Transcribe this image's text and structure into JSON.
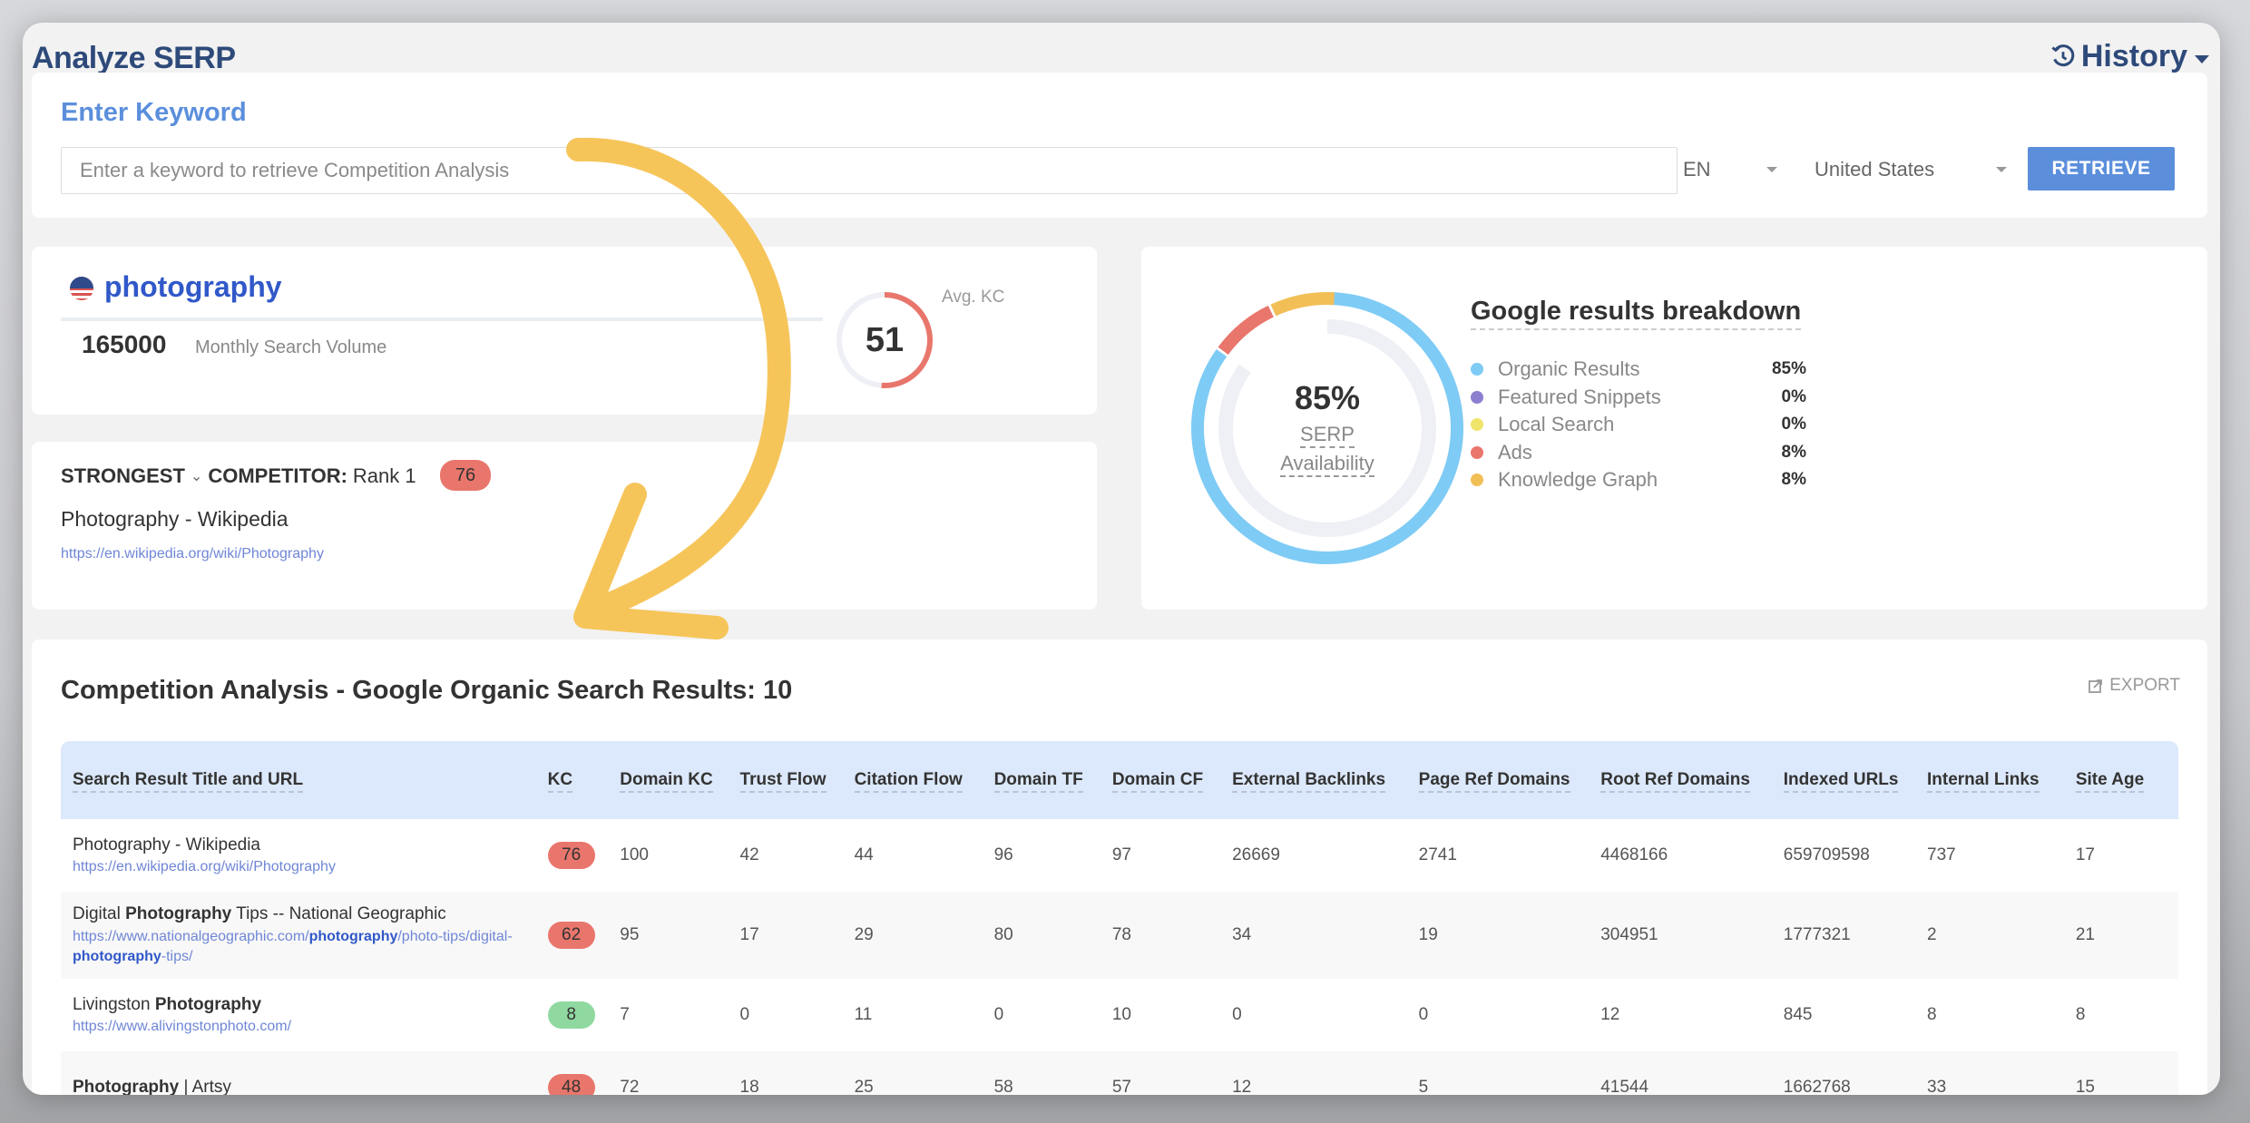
{
  "header": {
    "title": "Analyze SERP",
    "history_label": "History"
  },
  "keyword_form": {
    "label": "Enter Keyword",
    "input_value": "",
    "input_placeholder": "Enter a keyword to retrieve Competition Analysis",
    "language": "EN",
    "country": "United States",
    "retrieve_label": "RETRIEVE"
  },
  "summary": {
    "keyword": "photography",
    "flag": "us-flag-icon",
    "monthly_search_volume": "165000",
    "monthly_search_volume_label": "Monthly Search Volume",
    "avg_kc": "51",
    "avg_kc_fraction": 0.51,
    "avg_kc_label": "Avg. KC"
  },
  "strongest_competitor": {
    "label_strongest": "STRONGEST",
    "label_competitor": "COMPETITOR:",
    "rank_text": "Rank 1",
    "kc": "76",
    "title_bold": "Photography",
    "title_rest": " - Wikipedia",
    "url": "https://en.wikipedia.org/wiki/Photography"
  },
  "breakdown": {
    "title": "Google results breakdown",
    "center_value": "85%",
    "center_label_1": "SERP",
    "center_label_2": "Availability",
    "serp_availability_fraction": 0.85,
    "items": [
      {
        "name": "Organic Results",
        "value": "85%",
        "fraction": 0.85,
        "color": "#7ecbf5"
      },
      {
        "name": "Featured Snippets",
        "value": "0%",
        "fraction": 0.0,
        "color": "#8c7fd0"
      },
      {
        "name": "Local Search",
        "value": "0%",
        "fraction": 0.0,
        "color": "#f0e46a"
      },
      {
        "name": "Ads",
        "value": "8%",
        "fraction": 0.08,
        "color": "#e9766c"
      },
      {
        "name": "Knowledge Graph",
        "value": "8%",
        "fraction": 0.08,
        "color": "#f2bf57"
      }
    ]
  },
  "competition": {
    "title": "Competition Analysis - Google Organic Search Results: 10",
    "export_label": "EXPORT",
    "columns": [
      "Search Result Title and URL",
      "KC",
      "Domain KC",
      "Trust Flow",
      "Citation Flow",
      "Domain TF",
      "Domain CF",
      "External Backlinks",
      "Page Ref Domains",
      "Root Ref Domains",
      "Indexed URLs",
      "Internal Links",
      "Site Age"
    ],
    "rows": [
      {
        "title_parts": [
          {
            "text": "Photography - Wikipedia",
            "bold": false
          }
        ],
        "url_parts": [
          {
            "text": "https://en.wikipedia.org/wiki/Photography",
            "bold": false
          }
        ],
        "kc": "76",
        "kc_level": "high",
        "values": [
          "100",
          "42",
          "44",
          "96",
          "97",
          "26669",
          "2741",
          "4468166",
          "659709598",
          "737",
          "17"
        ]
      },
      {
        "title_parts": [
          {
            "text": "Digital ",
            "bold": false
          },
          {
            "text": "Photography",
            "bold": true
          },
          {
            "text": " Tips -- National Geographic",
            "bold": false
          }
        ],
        "url_parts": [
          {
            "text": "https://www.nationalgeographic.com/",
            "bold": false
          },
          {
            "text": "photography",
            "bold": true
          },
          {
            "text": "/photo-tips/digital-",
            "bold": false
          },
          {
            "text": "photography",
            "bold": true
          },
          {
            "text": "-tips/",
            "bold": false
          }
        ],
        "kc": "62",
        "kc_level": "high",
        "values": [
          "95",
          "17",
          "29",
          "80",
          "78",
          "34",
          "19",
          "304951",
          "1777321",
          "2",
          "21"
        ]
      },
      {
        "title_parts": [
          {
            "text": "Livingston ",
            "bold": false
          },
          {
            "text": "Photography",
            "bold": true
          }
        ],
        "url_parts": [
          {
            "text": "https://www.alivingstonphoto.com/",
            "bold": false
          }
        ],
        "kc": "8",
        "kc_level": "low",
        "values": [
          "7",
          "0",
          "11",
          "0",
          "10",
          "0",
          "0",
          "12",
          "845",
          "8",
          "8"
        ]
      },
      {
        "title_parts": [
          {
            "text": "Photography",
            "bold": true
          },
          {
            "text": " | Artsy",
            "bold": false
          }
        ],
        "url_parts": [],
        "kc": "48",
        "kc_level": "high",
        "values": [
          "72",
          "18",
          "25",
          "58",
          "57",
          "12",
          "5",
          "41544",
          "1662768",
          "33",
          "15"
        ]
      }
    ]
  },
  "colors": {
    "accent": "#5b8fdc",
    "title": "#2e4a7a",
    "kc_high": "#e9766c",
    "kc_low": "#8fd9a0",
    "annotation_arrow": "#f6c55a"
  }
}
